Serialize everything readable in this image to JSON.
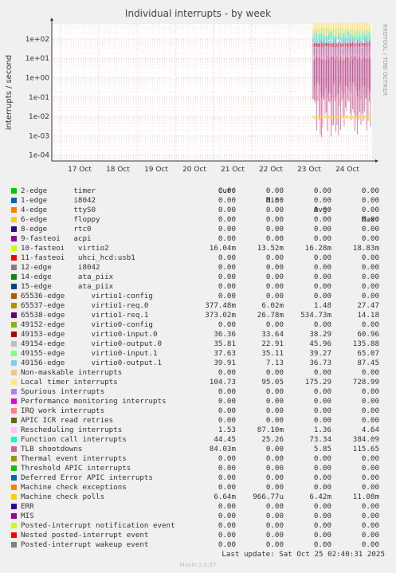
{
  "chart_data": {
    "type": "line",
    "title": "Individual interrupts - by week",
    "ylabel": "interrupts / second",
    "yscale": "log",
    "ylim": [
      5e-05,
      600
    ],
    "yticks": [
      "1e-04",
      "1e-03",
      "1e-02",
      "1e-01",
      "1e+00",
      "1e+01",
      "1e+02"
    ],
    "x_categories": [
      "17 Oct",
      "18 Oct",
      "19 Oct",
      "20 Oct",
      "21 Oct",
      "22 Oct",
      "23 Oct",
      "24 Oct"
    ],
    "data_start": "23 Oct",
    "side_text": "RRDTOOL / TOBI OETIKER",
    "series_bands": [
      {
        "name": "Function call interrupts",
        "color": "#33DDBB",
        "low": 25,
        "high": 384
      },
      {
        "name": "Local timer interrupts",
        "color": "#FFE066",
        "low": 95,
        "high": 729
      },
      {
        "name": "49155-edge virtio0-input.1",
        "color": "#99EE77",
        "low": 35,
        "high": 65
      },
      {
        "name": "49156-edge virtio0-output.1",
        "color": "#77BBFF",
        "low": 7,
        "high": 87
      },
      {
        "name": "49153-edge virtio0-input.0",
        "color": "#CC0000",
        "low": 33,
        "high": 61
      },
      {
        "name": "65538-edge virtio1-req.1",
        "color": "#660066",
        "low": 0.027,
        "high": 14
      },
      {
        "name": "TLB shootdowns",
        "color": "#CC6699",
        "low": 0.0001,
        "high": 115
      },
      {
        "name": "Machine check polls",
        "color": "#FFCC00",
        "low": 0.007,
        "high": 0.011
      }
    ]
  },
  "legend": {
    "headers": [
      "Cur:",
      "Min:",
      "Avg:",
      "Max:"
    ],
    "rows": [
      {
        "label": "2-edge      timer",
        "color": "#00CC00",
        "cur": "0.00",
        "min": "0.00",
        "avg": "0.00",
        "max": "0.00"
      },
      {
        "label": "1-edge      i8042",
        "color": "#0066B3",
        "cur": "0.00",
        "min": "0.00",
        "avg": "0.00",
        "max": "0.00"
      },
      {
        "label": "4-edge      ttyS0",
        "color": "#FF8000",
        "cur": "0.00",
        "min": "0.00",
        "avg": "0.00",
        "max": "0.00"
      },
      {
        "label": "6-edge      floppy",
        "color": "#FFCC00",
        "cur": "0.00",
        "min": "0.00",
        "avg": "0.00",
        "max": "0.00"
      },
      {
        "label": "8-edge      rtc0",
        "color": "#330099",
        "cur": "0.00",
        "min": "0.00",
        "avg": "0.00",
        "max": "0.00"
      },
      {
        "label": "9-fasteoi   acpi",
        "color": "#990099",
        "cur": "0.00",
        "min": "0.00",
        "avg": "0.00",
        "max": "0.00"
      },
      {
        "label": "10-fasteoi   virtio2",
        "color": "#CCFF00",
        "cur": "16.04m",
        "min": "13.52m",
        "avg": "16.28m",
        "max": "18.83m"
      },
      {
        "label": "11-fasteoi   uhci_hcd:usb1",
        "color": "#FF0000",
        "cur": "0.00",
        "min": "0.00",
        "avg": "0.00",
        "max": "0.00"
      },
      {
        "label": "12-edge      i8042",
        "color": "#808080",
        "cur": "0.00",
        "min": "0.00",
        "avg": "0.00",
        "max": "0.00"
      },
      {
        "label": "14-edge      ata_piix",
        "color": "#008F00",
        "cur": "0.00",
        "min": "0.00",
        "avg": "0.00",
        "max": "0.00"
      },
      {
        "label": "15-edge      ata_piix",
        "color": "#00487D",
        "cur": "0.00",
        "min": "0.00",
        "avg": "0.00",
        "max": "0.00"
      },
      {
        "label": "65536-edge      virtio1-config",
        "color": "#B35A00",
        "cur": "0.00",
        "min": "0.00",
        "avg": "0.00",
        "max": "0.00"
      },
      {
        "label": "65537-edge      virtio1-req.0",
        "color": "#B38F00",
        "cur": "377.48m",
        "min": "6.02m",
        "avg": "1.48",
        "max": "27.47"
      },
      {
        "label": "65538-edge      virtio1-req.1",
        "color": "#6B006B",
        "cur": "373.02m",
        "min": "26.78m",
        "avg": "534.73m",
        "max": "14.18"
      },
      {
        "label": "49152-edge      virtio0-config",
        "color": "#8FB300",
        "cur": "0.00",
        "min": "0.00",
        "avg": "0.00",
        "max": "0.00"
      },
      {
        "label": "49153-edge      virtio0-input.0",
        "color": "#B30000",
        "cur": "36.36",
        "min": "33.64",
        "avg": "38.29",
        "max": "60.96"
      },
      {
        "label": "49154-edge      virtio0-output.0",
        "color": "#BEBEBE",
        "cur": "35.81",
        "min": "22.91",
        "avg": "45.96",
        "max": "135.88"
      },
      {
        "label": "49155-edge      virtio0-input.1",
        "color": "#80FF80",
        "cur": "37.63",
        "min": "35.11",
        "avg": "39.27",
        "max": "65.07"
      },
      {
        "label": "49156-edge      virtio0-output.1",
        "color": "#80C9FF",
        "cur": "39.91",
        "min": "7.13",
        "avg": "36.73",
        "max": "87.45"
      },
      {
        "label": "Non-maskable interrupts",
        "color": "#FFC080",
        "cur": "0.00",
        "min": "0.00",
        "avg": "0.00",
        "max": "0.00"
      },
      {
        "label": "Local timer interrupts",
        "color": "#FFE680",
        "cur": "104.73",
        "min": "95.05",
        "avg": "175.29",
        "max": "728.99"
      },
      {
        "label": "Spurious interrupts",
        "color": "#AA80FF",
        "cur": "0.00",
        "min": "0.00",
        "avg": "0.00",
        "max": "0.00"
      },
      {
        "label": "Performance monitoring interrupts",
        "color": "#EE00CC",
        "cur": "0.00",
        "min": "0.00",
        "avg": "0.00",
        "max": "0.00"
      },
      {
        "label": "IRQ work interrupts",
        "color": "#FF8080",
        "cur": "0.00",
        "min": "0.00",
        "avg": "0.00",
        "max": "0.00"
      },
      {
        "label": "APIC ICR read retries",
        "color": "#666600",
        "cur": "0.00",
        "min": "0.00",
        "avg": "0.00",
        "max": "0.00"
      },
      {
        "label": "Rescheduling interrupts",
        "color": "#FFBFFF",
        "cur": "1.53",
        "min": "87.10m",
        "avg": "1.36",
        "max": "4.64"
      },
      {
        "label": "Function call interrupts",
        "color": "#00FFCC",
        "cur": "44.45",
        "min": "25.26",
        "avg": "73.34",
        "max": "384.09"
      },
      {
        "label": "TLB shootdowns",
        "color": "#CC6699",
        "cur": "84.03m",
        "min": "0.00",
        "avg": "5.85",
        "max": "115.65"
      },
      {
        "label": "Thermal event interrupts",
        "color": "#999900",
        "cur": "0.00",
        "min": "0.00",
        "avg": "0.00",
        "max": "0.00"
      },
      {
        "label": "Threshold APIC interrupts",
        "color": "#00CC00",
        "cur": "0.00",
        "min": "0.00",
        "avg": "0.00",
        "max": "0.00"
      },
      {
        "label": "Deferred Error APIC interrupts",
        "color": "#0066B3",
        "cur": "0.00",
        "min": "0.00",
        "avg": "0.00",
        "max": "0.00"
      },
      {
        "label": "Machine check exceptions",
        "color": "#FF8000",
        "cur": "0.00",
        "min": "0.00",
        "avg": "0.00",
        "max": "0.00"
      },
      {
        "label": "Machine check polls",
        "color": "#FFCC00",
        "cur": "6.64m",
        "min": "966.77u",
        "avg": "6.42m",
        "max": "11.08m"
      },
      {
        "label": "ERR",
        "color": "#330099",
        "cur": "0.00",
        "min": "0.00",
        "avg": "0.00",
        "max": "0.00"
      },
      {
        "label": "MIS",
        "color": "#990099",
        "cur": "0.00",
        "min": "0.00",
        "avg": "0.00",
        "max": "0.00"
      },
      {
        "label": "Posted-interrupt notification event",
        "color": "#CCFF00",
        "cur": "0.00",
        "min": "0.00",
        "avg": "0.00",
        "max": "0.00"
      },
      {
        "label": "Nested posted-interrupt event",
        "color": "#FF0000",
        "cur": "0.00",
        "min": "0.00",
        "avg": "0.00",
        "max": "0.00"
      },
      {
        "label": "Posted-interrupt wakeup event",
        "color": "#808080",
        "cur": "0.00",
        "min": "0.00",
        "avg": "0.00",
        "max": "0.00"
      }
    ]
  },
  "footer": {
    "last_update": "Last update: Sat Oct 25 02:40:31 2025",
    "munin": "Munin 2.0.57"
  }
}
